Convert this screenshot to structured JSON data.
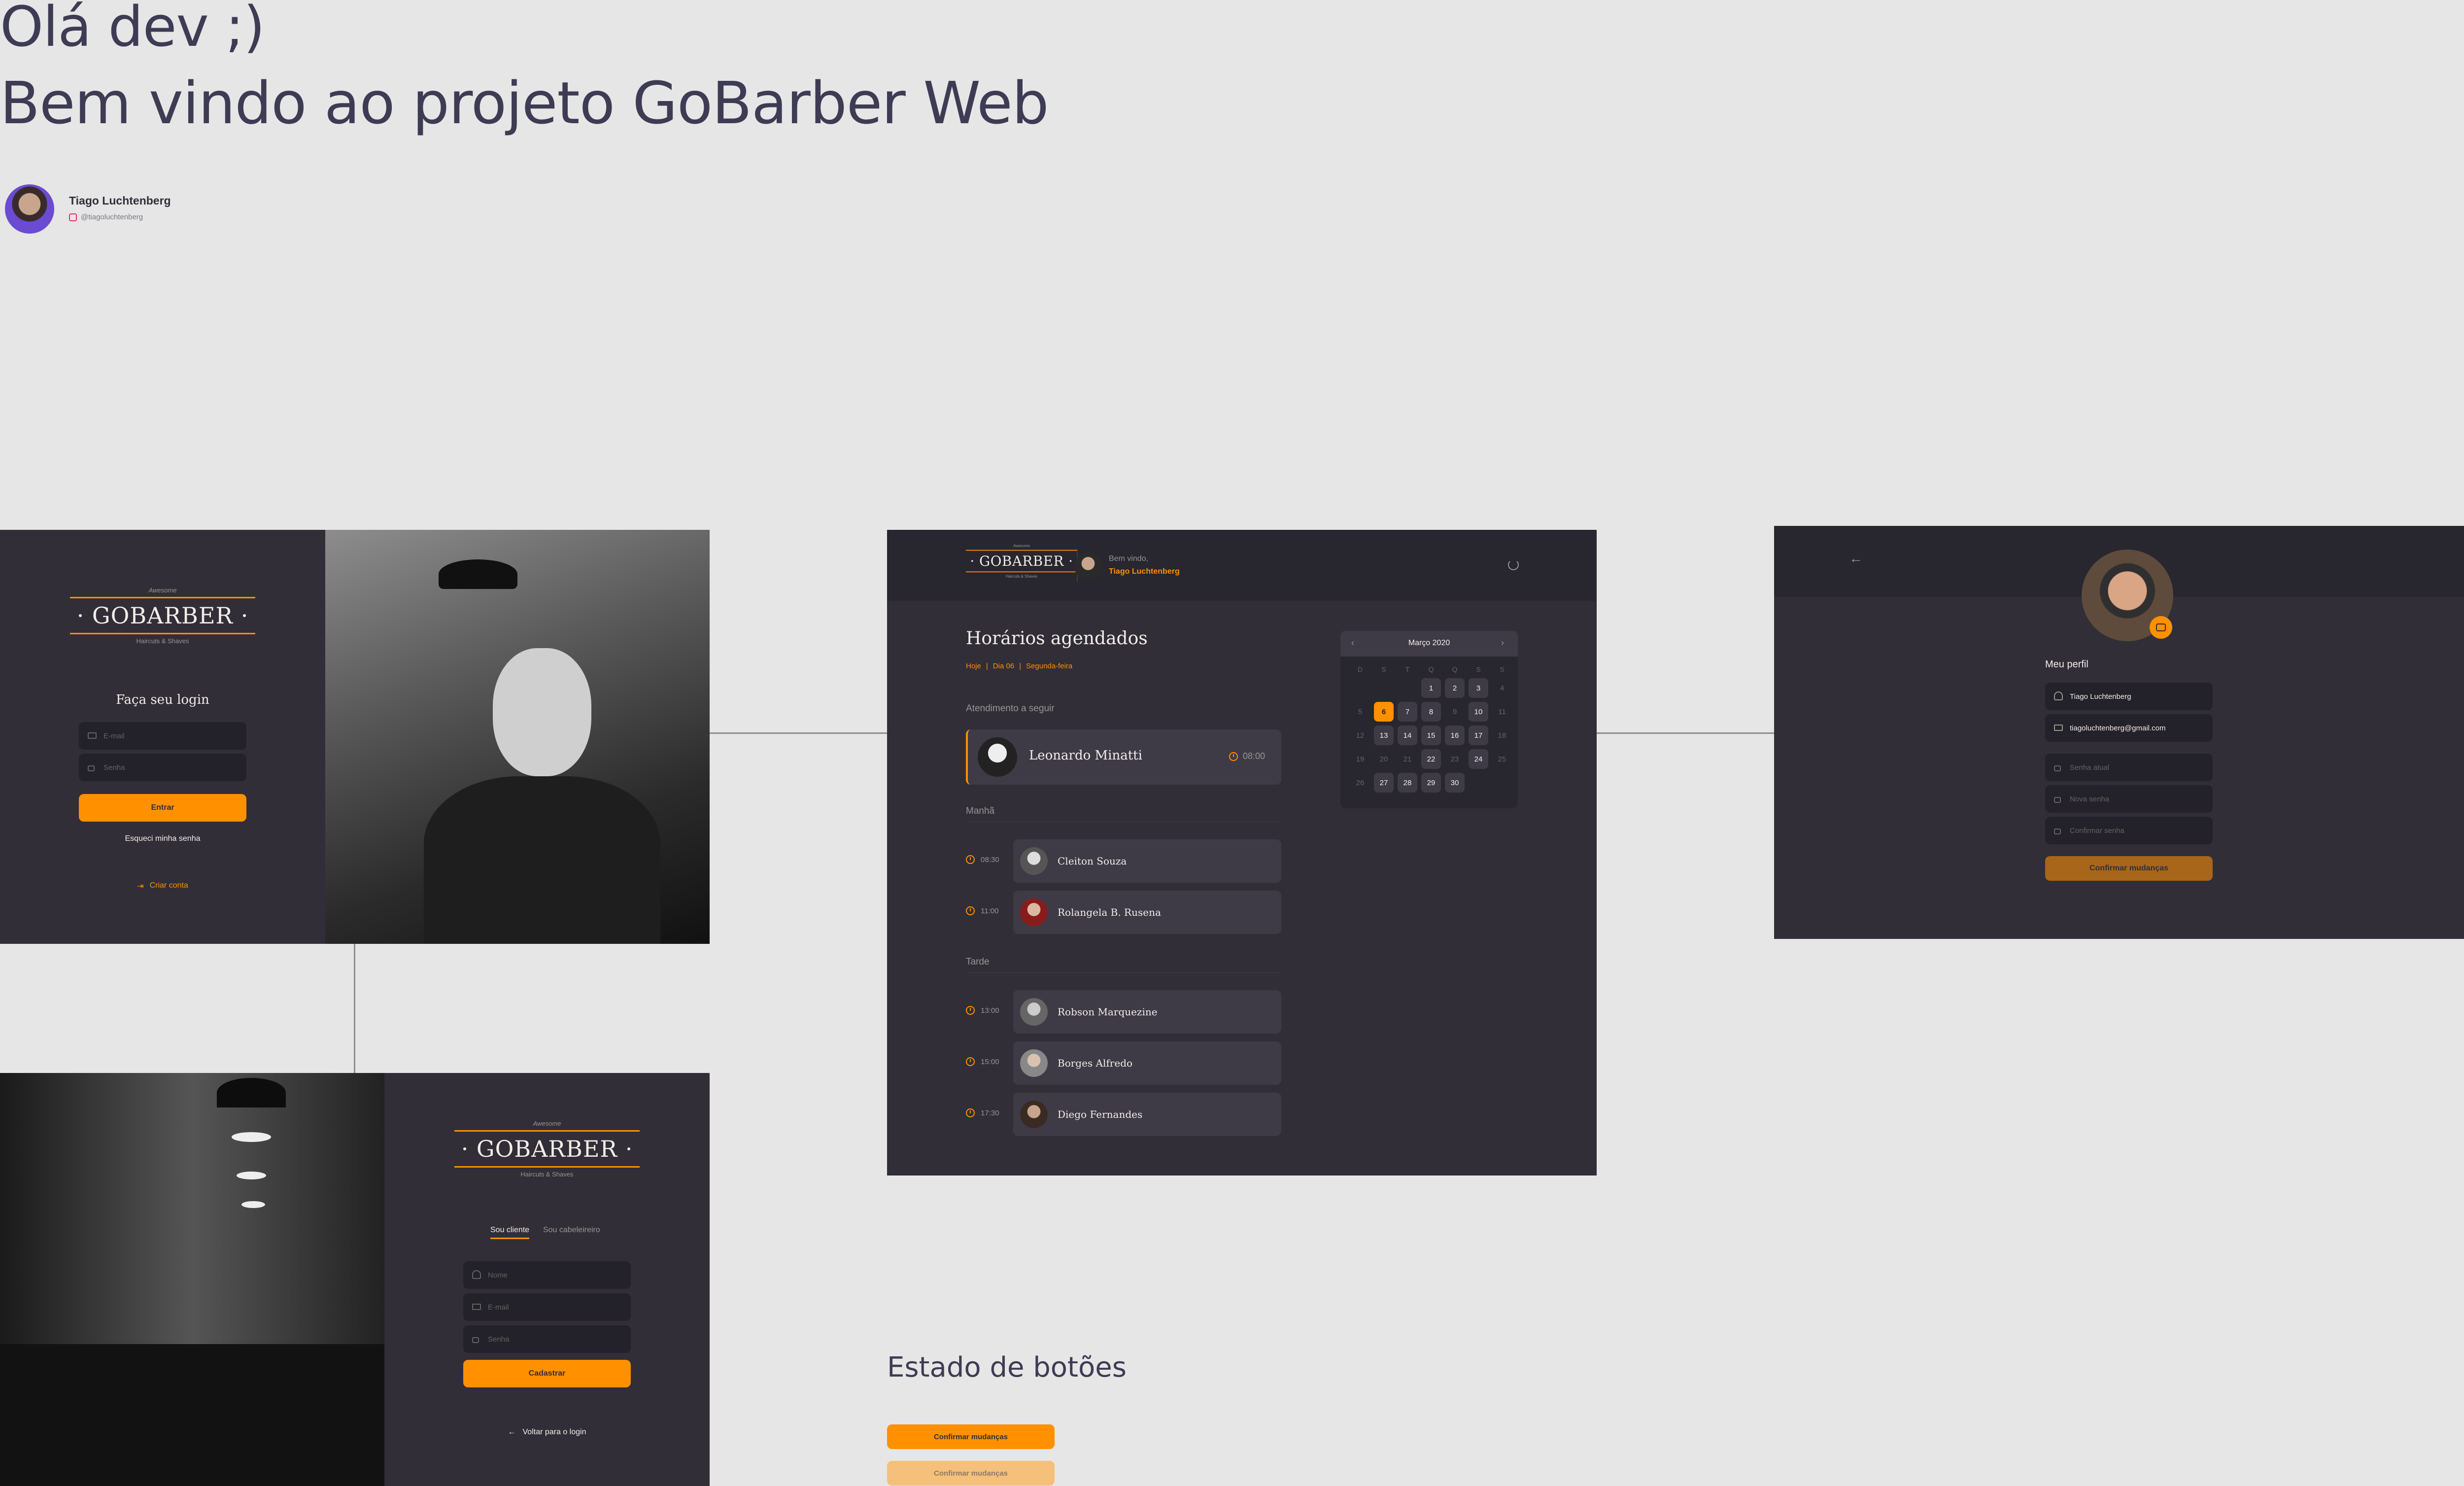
{
  "header": {
    "greeting": "Olá dev ;)",
    "welcome": "Bem vindo ao projeto GoBarber Web",
    "author_name": "Tiago Luchtenberg",
    "author_handle": "@tiagoluchtenberg"
  },
  "logo": {
    "top": "Awesome",
    "main": "· GOBARBER ·",
    "sub": "Haircuts & Shaves"
  },
  "login": {
    "title": "Faça seu login",
    "email_placeholder": "E-mail",
    "password_placeholder": "Senha",
    "submit": "Entrar",
    "forgot": "Esqueci minha senha",
    "create_account": "Criar conta"
  },
  "signup": {
    "tab_client": "Sou cliente",
    "tab_barber": "Sou cabeleireiro",
    "name_placeholder": "Nome",
    "email_placeholder": "E-mail",
    "password_placeholder": "Senha",
    "submit": "Cadastrar",
    "back": "Voltar para o login"
  },
  "dashboard": {
    "welcome": "Bem vindo,",
    "user": "Tiago Luchtenberg",
    "title": "Horários agendados",
    "today": "Hoje",
    "day": "Dia 06",
    "weekday": "Segunda-feira",
    "next_label": "Atendimento a seguir",
    "next": {
      "name": "Leonardo Minatti",
      "time": "08:00"
    },
    "morning_label": "Manhã",
    "morning": [
      {
        "time": "08:30",
        "name": "Cleiton Souza"
      },
      {
        "time": "11:00",
        "name": "Rolangela B. Rusena"
      }
    ],
    "afternoon_label": "Tarde",
    "afternoon": [
      {
        "time": "13:00",
        "name": "Robson Marquezine"
      },
      {
        "time": "15:00",
        "name": "Borges Alfredo"
      },
      {
        "time": "17:30",
        "name": "Diego Fernandes"
      }
    ],
    "calendar": {
      "month": "Março 2020",
      "prev": "‹",
      "next": "›",
      "weekdays": [
        "D",
        "S",
        "T",
        "Q",
        "Q",
        "S",
        "S"
      ]
    }
  },
  "profile": {
    "title": "Meu perfil",
    "name_value": "Tiago Luchtenberg",
    "email_value": "tiagoluchtenberg@gmail.com",
    "current_password": "Senha atual",
    "new_password": "Nova senha",
    "confirm_password": "Confirmar senha",
    "submit": "Confirmar mudanças"
  },
  "buttons_state": {
    "title": "Estado de botões",
    "normal": "Confirmar mudanças",
    "disabled": "Confirmar mudanças"
  },
  "colors": {
    "orange": "#ff9000",
    "background": "#312e38",
    "header": "#28262e",
    "input": "#232129",
    "card": "#3e3b47"
  }
}
